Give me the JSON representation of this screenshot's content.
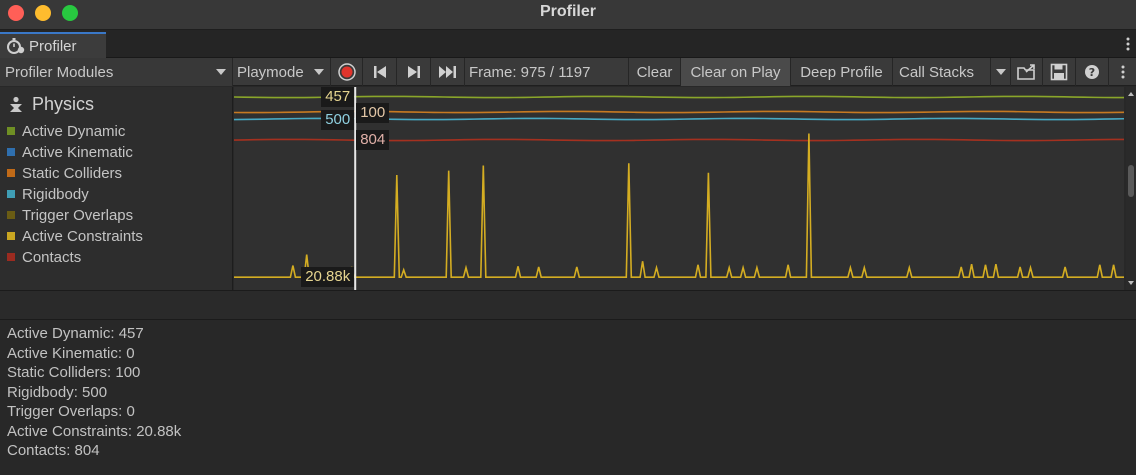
{
  "window": {
    "title": "Profiler"
  },
  "tab": {
    "label": "Profiler"
  },
  "toolbar": {
    "modules_label": "Profiler Modules",
    "playmode_label": "Playmode",
    "frame_text": "Frame: 975 / 1197",
    "clear_label": "Clear",
    "clear_on_play_label": "Clear on Play",
    "deep_profile_label": "Deep Profile",
    "call_stacks_label": "Call Stacks"
  },
  "module": {
    "title": "Physics",
    "items": [
      {
        "label": "Active Dynamic",
        "color": "#6f8f24"
      },
      {
        "label": "Active Kinematic",
        "color": "#2f6fae"
      },
      {
        "label": "Static Colliders",
        "color": "#c06a18"
      },
      {
        "label": "Rigidbody",
        "color": "#3f9db4"
      },
      {
        "label": "Trigger Overlaps",
        "color": "#6a5c14"
      },
      {
        "label": "Active Constraints",
        "color": "#c9a621"
      },
      {
        "label": "Contacts",
        "color": "#9b2b20"
      }
    ]
  },
  "chart_data": {
    "type": "line",
    "frame_range": [
      940,
      1197
    ],
    "selected_frame": 975,
    "value_labels": [
      {
        "series": "Active Dynamic",
        "text": "457"
      },
      {
        "series": "Static Colliders",
        "text": "100"
      },
      {
        "series": "Rigidbody",
        "text": "500"
      },
      {
        "series": "Contacts",
        "text": "804"
      },
      {
        "series": "Active Constraints",
        "text": "20.88k"
      }
    ],
    "series": [
      {
        "name": "Active Dynamic",
        "color": "#8aa62a",
        "constant": 457
      },
      {
        "name": "Static Colliders",
        "color": "#c77a22",
        "constant": 100
      },
      {
        "name": "Rigidbody",
        "color": "#47a9c3",
        "constant": 500
      },
      {
        "name": "Contacts",
        "color": "#a5301f",
        "constant": 804
      },
      {
        "name": "Active Constraints",
        "color": "#d4ad22",
        "baseline": 1200,
        "spikes": [
          [
            957,
            2800
          ],
          [
            961,
            4300
          ],
          [
            974,
            2600
          ],
          [
            987,
            15200
          ],
          [
            989,
            2200
          ],
          [
            1002,
            15800
          ],
          [
            1007,
            2500
          ],
          [
            1012,
            16500
          ],
          [
            1022,
            2700
          ],
          [
            1028,
            2600
          ],
          [
            1039,
            2600
          ],
          [
            1054,
            16800
          ],
          [
            1058,
            3400
          ],
          [
            1062,
            2500
          ],
          [
            1074,
            2900
          ],
          [
            1077,
            15500
          ],
          [
            1083,
            2500
          ],
          [
            1087,
            2500
          ],
          [
            1091,
            2500
          ],
          [
            1100,
            2900
          ],
          [
            1106,
            20880
          ],
          [
            1118,
            2500
          ],
          [
            1122,
            2500
          ],
          [
            1135,
            2500
          ],
          [
            1150,
            2600
          ],
          [
            1153,
            3000
          ],
          [
            1157,
            2900
          ],
          [
            1160,
            3000
          ],
          [
            1167,
            2600
          ],
          [
            1170,
            2500
          ],
          [
            1180,
            2600
          ],
          [
            1190,
            2900
          ],
          [
            1194,
            2900
          ]
        ]
      }
    ]
  },
  "details": {
    "lines": [
      "Active Dynamic: 457",
      "Active Kinematic: 0",
      "Static Colliders: 100",
      "Rigidbody: 500",
      "Trigger Overlaps: 0",
      "Active Constraints: 20.88k",
      "Contacts: 804"
    ]
  }
}
